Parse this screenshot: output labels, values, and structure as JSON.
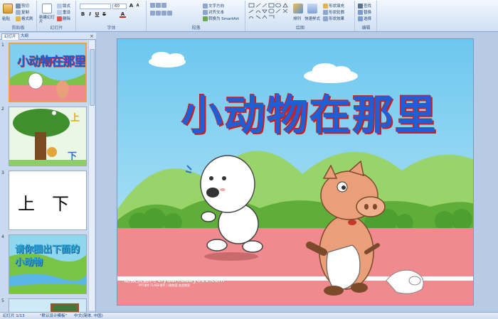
{
  "ribbon": {
    "clipboard": {
      "label": "剪贴板",
      "paste": "粘贴",
      "cut": "剪切",
      "copy": "复制",
      "format_painter": "格式刷"
    },
    "slides": {
      "label": "幻灯片",
      "new_slide": "新建幻灯片",
      "layout": "版式",
      "reset": "重设",
      "delete": "删除"
    },
    "font": {
      "label": "字体",
      "font_name": "",
      "font_size": "60",
      "grow": "A",
      "shrink": "A"
    },
    "paragraph": {
      "label": "段落",
      "text_direction": "文字方向",
      "align_text": "对齐文本",
      "smartart": "转换为 SmartArt"
    },
    "drawing": {
      "label": "绘图",
      "arrange": "排列",
      "quick_styles": "快速样式",
      "shape_fill": "形状填充",
      "shape_outline": "形状轮廓",
      "shape_effects": "形状效果"
    },
    "editing": {
      "label": "编辑",
      "find": "查找",
      "replace": "替换",
      "select": "选择"
    }
  },
  "leftpane": {
    "tab_slides": "幻灯片",
    "tab_outline": "大纲",
    "close": "×",
    "thumbs": [
      {
        "num": "1",
        "title": "小动物在那里"
      },
      {
        "num": "2",
        "up": "上",
        "down": "下"
      },
      {
        "num": "3",
        "text": "上　下"
      },
      {
        "num": "4",
        "text": "请你圈出下面的小动物"
      },
      {
        "num": "5"
      }
    ]
  },
  "slide": {
    "title": "小动物在那里",
    "watermark": "幼教资源网 ziyuan.baby611.com",
    "watermark_small": "PPT课件 FLASH课件 儿歌教案 各类教案"
  },
  "status": {
    "slide_info": "幻灯片 1/13",
    "theme": "\"默认设计模板\"",
    "language": "中文(简体, 中国)"
  },
  "colors": {
    "sky": "#7fd0f0",
    "grass": "#7cc24b",
    "track": "#f08a8e",
    "title_blue": "#1e5fd8",
    "title_red": "#c8201e"
  }
}
